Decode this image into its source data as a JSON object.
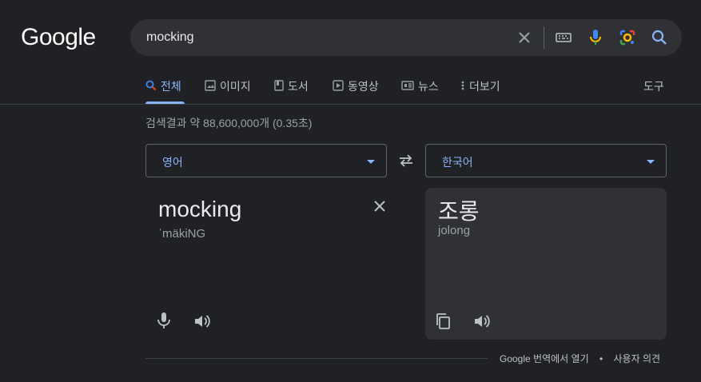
{
  "logo": "Google",
  "search": {
    "query": "mocking"
  },
  "tabs": [
    {
      "label": "전체",
      "icon": "search-icon",
      "active": true
    },
    {
      "label": "이미지",
      "icon": "image-icon"
    },
    {
      "label": "도서",
      "icon": "book-icon"
    },
    {
      "label": "동영상",
      "icon": "video-icon"
    },
    {
      "label": "뉴스",
      "icon": "news-icon"
    },
    {
      "label": "더보기",
      "icon": "more-vert-icon"
    }
  ],
  "tools_label": "도구",
  "stats": "검색결과 약 88,600,000개 (0.35초)",
  "translate": {
    "source_lang": "영어",
    "target_lang": "한국어",
    "source_text": "mocking",
    "source_pronunciation": "ˈmäkiNG",
    "target_text": "조롱",
    "target_romanization": "jolong"
  },
  "footer": {
    "open_link": "Google 번역에서 열기",
    "separator": "•",
    "feedback": "사용자 의견"
  },
  "colors": {
    "background": "#202124",
    "surface": "#303134",
    "accent": "#8ab4f8",
    "text": "#e8eaed",
    "muted": "#9aa0a6"
  }
}
